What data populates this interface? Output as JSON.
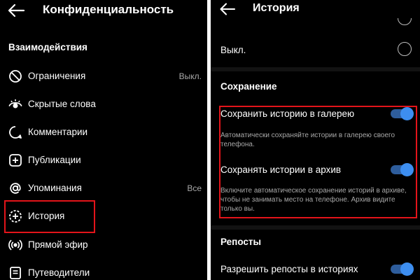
{
  "left_panel": {
    "title": "Конфиденциальность",
    "section_label": "Взаимодействия",
    "items": [
      {
        "label": "Ограничения",
        "value": "Выкл.",
        "icon": "restrict-icon"
      },
      {
        "label": "Скрытые слова",
        "value": "",
        "icon": "eye-icon"
      },
      {
        "label": "Комментарии",
        "value": "",
        "icon": "comment-icon"
      },
      {
        "label": "Публикации",
        "value": "",
        "icon": "add-square-icon"
      },
      {
        "label": "Упоминания",
        "value": "Все",
        "icon": "at-sign-icon"
      },
      {
        "label": "История",
        "value": "",
        "icon": "story-add-icon"
      },
      {
        "label": "Прямой эфир",
        "value": "",
        "icon": "live-icon"
      },
      {
        "label": "Путеводители",
        "value": "",
        "icon": "guide-icon"
      }
    ]
  },
  "right_panel": {
    "title": "История",
    "off_option": {
      "label": "Выкл.",
      "selected": false
    },
    "saving_section": {
      "label": "Сохранение",
      "save_to_gallery": {
        "label": "Сохранить историю в галерею",
        "enabled": true,
        "description": "Автоматически сохраняйте истории в галерею своего телефона."
      },
      "save_to_archive": {
        "label": "Сохранять истории в архив",
        "enabled": true,
        "description": "Включите автоматическое сохранение историй в архиве, чтобы не занимать место на телефоне. Архив видите только вы."
      }
    },
    "reposts_section": {
      "label": "Репосты",
      "allow_reposts": {
        "label": "Разрешить репосты в историях",
        "enabled": true
      }
    }
  },
  "colors": {
    "background": "#000000",
    "text": "#ffffff",
    "secondary_text": "#a8a8a8",
    "toggle_on": "#3d8ef0",
    "highlight": "#e3141a"
  }
}
